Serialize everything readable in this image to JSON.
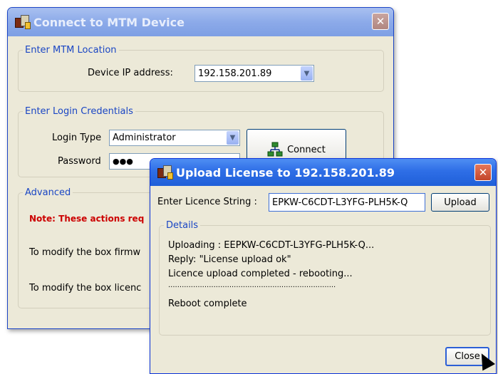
{
  "connect_window": {
    "title": "Connect to MTM Device",
    "close_glyph": "✕",
    "location_group": {
      "legend": "Enter MTM Location",
      "ip_label": "Device IP address:",
      "ip_value": "192.158.201.89"
    },
    "login_group": {
      "legend": "Enter Login Credentials",
      "login_type_label": "Login Type",
      "login_type_value": "Administrator",
      "password_label": "Password",
      "password_value": "●●●",
      "connect_label": "Connect"
    },
    "advanced_group": {
      "legend": "Advanced",
      "note": "Note: These actions req",
      "firmware_text": "To modify the box firmw",
      "licence_text": "To modify the box licenc"
    }
  },
  "upload_window": {
    "title": "Upload License to 192.158.201.89",
    "close_glyph": "✕",
    "licence_label": "Enter Licence String :",
    "licence_value": "EPKW-C6CDT-L3YFG-PLH5K-Q",
    "upload_label": "Upload",
    "details": {
      "legend": "Details",
      "lines": [
        "Uploading : EEPKW-C6CDT-L3YFG-PLH5K-Q...",
        "Reply: \"License upload ok\"",
        "Licence upload completed - rebooting...",
        "..........................................................................",
        "Reboot complete"
      ]
    },
    "close_label": "Close"
  }
}
